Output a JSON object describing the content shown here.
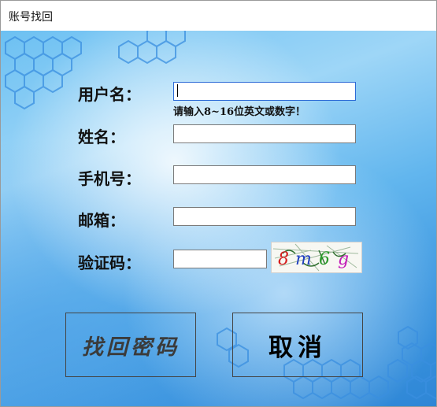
{
  "window": {
    "title": "账号找回"
  },
  "form": {
    "username_label": "用户名：",
    "username_value": "",
    "username_hint": "请输入8~16位英文或数字！",
    "name_label": "姓名：",
    "name_value": "",
    "phone_label": "手机号：",
    "phone_value": "",
    "email_label": "邮箱：",
    "email_value": "",
    "captcha_label": "验证码：",
    "captcha_value": "",
    "captcha_image_text": "8m6g"
  },
  "buttons": {
    "recover_label": "找回密码",
    "cancel_label": "取消"
  },
  "colors": {
    "background_accent": "#3b95df",
    "hex_outline": "#3a8fe0",
    "captcha_chars": [
      "#d61e1e",
      "#1f3fbf",
      "#2a9a2a",
      "#c21bb8"
    ]
  }
}
